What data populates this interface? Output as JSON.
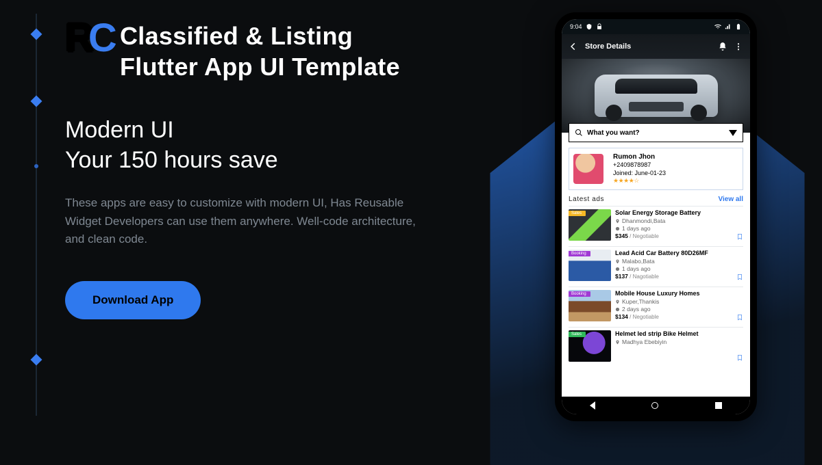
{
  "logo": {
    "r": "R",
    "c": "C"
  },
  "heading_line1": "Classified & Listing",
  "heading_line2": "Flutter App UI Template",
  "subhead_line1": "Modern UI",
  "subhead_line2": "Your 150 hours save",
  "body": "These apps are easy to customize with modern UI, Has Reusable Widget Developers can use them anywhere. Well-code architecture, and clean code.",
  "cta": "Download App",
  "phone": {
    "status_time": "9:04",
    "appbar_title": "Store Details",
    "search_placeholder": "What you want?",
    "profile": {
      "name": "Rumon Jhon",
      "phone": "+2409878987",
      "joined": "Joined: June-01-23",
      "stars": "★★★★☆"
    },
    "section": {
      "title": "Latest ads",
      "viewall": "View all"
    },
    "ads": [
      {
        "badge": "Sales",
        "badge_class": "sales",
        "title": "Solar Energy Storage Battery",
        "location": "Dhanmondi,Bata",
        "time": "1 days ago",
        "price": "$345",
        "neg": " / Negotiable",
        "thumb": "t1"
      },
      {
        "badge": "Booking",
        "badge_class": "booking",
        "title": "Lead Acid Car Battery 80D26MF",
        "location": "Malabo,Bata",
        "time": "1 days ago",
        "price": "$137",
        "neg": " / Nagotiable",
        "thumb": "t2"
      },
      {
        "badge": "Booking",
        "badge_class": "booking",
        "title": "Mobile House Luxury Homes",
        "location": "Kuper,Thankis",
        "time": "2 days ago",
        "price": "$134",
        "neg": " / Negotiable",
        "thumb": "t3"
      },
      {
        "badge": "Sales",
        "badge_class": "sales2",
        "title": "Helmet led strip Bike Helmet",
        "location": "Madhya Ebebiyin",
        "time": "",
        "price": "",
        "neg": "",
        "thumb": "t4"
      }
    ]
  }
}
